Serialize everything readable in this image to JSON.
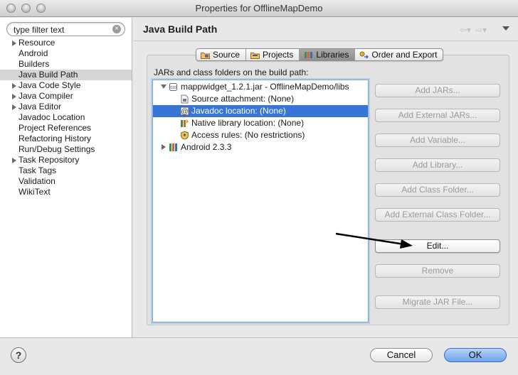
{
  "window": {
    "title": "Properties for OfflineMapDemo"
  },
  "filter": {
    "placeholder": "type filter text",
    "value": "type filter text"
  },
  "sidebar": {
    "items": [
      {
        "label": "Resource",
        "expandable": true,
        "selected": false
      },
      {
        "label": "Android",
        "expandable": false,
        "selected": false
      },
      {
        "label": "Builders",
        "expandable": false,
        "selected": false
      },
      {
        "label": "Java Build Path",
        "expandable": false,
        "selected": true
      },
      {
        "label": "Java Code Style",
        "expandable": true,
        "selected": false
      },
      {
        "label": "Java Compiler",
        "expandable": true,
        "selected": false
      },
      {
        "label": "Java Editor",
        "expandable": true,
        "selected": false
      },
      {
        "label": "Javadoc Location",
        "expandable": false,
        "selected": false
      },
      {
        "label": "Project References",
        "expandable": false,
        "selected": false
      },
      {
        "label": "Refactoring History",
        "expandable": false,
        "selected": false
      },
      {
        "label": "Run/Debug Settings",
        "expandable": false,
        "selected": false
      },
      {
        "label": "Task Repository",
        "expandable": true,
        "selected": false
      },
      {
        "label": "Task Tags",
        "expandable": false,
        "selected": false
      },
      {
        "label": "Validation",
        "expandable": false,
        "selected": false
      },
      {
        "label": "WikiText",
        "expandable": false,
        "selected": false
      }
    ]
  },
  "page": {
    "title": "Java Build Path"
  },
  "tabs": [
    {
      "label": "Source",
      "icon": "source-folder-icon",
      "active": false
    },
    {
      "label": "Projects",
      "icon": "projects-icon",
      "active": false
    },
    {
      "label": "Libraries",
      "icon": "libraries-icon",
      "active": true
    },
    {
      "label": "Order and Export",
      "icon": "order-export-icon",
      "active": false
    }
  ],
  "libraries": {
    "label": "JARs and class folders on the build path:",
    "rows": [
      {
        "label": "mappwidget_1.2.1.jar - OfflineMapDemo/libs",
        "icon": "jar-icon",
        "expanded": true,
        "level": 0,
        "selected": false
      },
      {
        "label": "Source attachment: (None)",
        "icon": "source-attachment-icon",
        "level": 1,
        "selected": false
      },
      {
        "label": "Javadoc location: (None)",
        "icon": "javadoc-icon",
        "level": 1,
        "selected": true
      },
      {
        "label": "Native library location: (None)",
        "icon": "native-library-icon",
        "level": 1,
        "selected": false
      },
      {
        "label": "Access rules: (No restrictions)",
        "icon": "access-rules-icon",
        "level": 1,
        "selected": false
      },
      {
        "label": "Android 2.3.3",
        "icon": "library-container-icon",
        "expanded": false,
        "level": 0,
        "selected": false
      }
    ]
  },
  "side_buttons": [
    {
      "label": "Add JARs...",
      "enabled": false
    },
    {
      "label": "Add External JARs...",
      "enabled": false
    },
    {
      "label": "Add Variable...",
      "enabled": false
    },
    {
      "label": "Add Library...",
      "enabled": false
    },
    {
      "label": "Add Class Folder...",
      "enabled": false
    },
    {
      "label": "Add External Class Folder...",
      "enabled": false
    },
    {
      "label": "Edit...",
      "enabled": true
    },
    {
      "label": "Remove",
      "enabled": false
    },
    {
      "label": "Migrate JAR File...",
      "enabled": false
    }
  ],
  "footer": {
    "help_glyph": "?",
    "cancel_label": "Cancel",
    "ok_label": "OK"
  }
}
